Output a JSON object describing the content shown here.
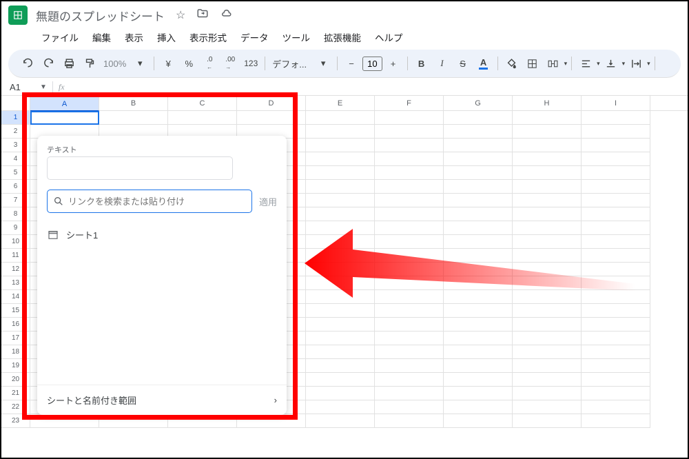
{
  "doc": {
    "title": "無題のスプレッドシート"
  },
  "menus": [
    "ファイル",
    "編集",
    "表示",
    "挿入",
    "表示形式",
    "データ",
    "ツール",
    "拡張機能",
    "ヘルプ"
  ],
  "toolbar": {
    "zoom": "100%",
    "currency": "¥",
    "percent": "%",
    "dec_minus": ".0",
    "dec_plus": ".00",
    "num": "123",
    "font": "デフォ...",
    "minus": "−",
    "font_size": "10",
    "plus": "+",
    "bold": "B",
    "italic": "I",
    "strike": "S",
    "color": "A"
  },
  "cell_ref": "A1",
  "columns": [
    "A",
    "B",
    "C",
    "D",
    "E",
    "F",
    "G",
    "H",
    "I"
  ],
  "rows": [
    "1",
    "2",
    "3",
    "4",
    "5",
    "6",
    "7",
    "8",
    "9",
    "10",
    "11",
    "12",
    "13",
    "14",
    "15",
    "16",
    "17",
    "18",
    "19",
    "20",
    "21",
    "22",
    "23"
  ],
  "dialog": {
    "text_label": "テキスト",
    "link_placeholder": "リンクを検索または貼り付け",
    "apply": "適用",
    "suggestion": "シート1",
    "footer": "シートと名前付き範囲"
  }
}
